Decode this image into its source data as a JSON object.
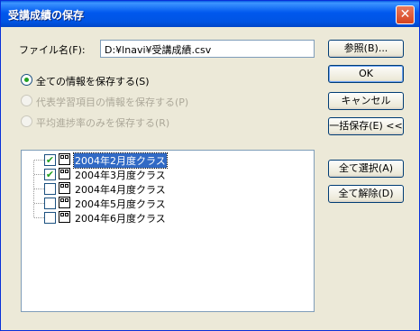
{
  "window": {
    "title": "受講成績の保存",
    "close_glyph": "✕"
  },
  "file": {
    "label": "ファイル名(F):",
    "value": "D:¥lnavi¥受講成績.csv"
  },
  "buttons": {
    "browse": "参照(B)...",
    "ok": "OK",
    "cancel": "キャンセル",
    "bulk_save": "一括保存(E) <<",
    "select_all": "全て選択(A)",
    "deselect_all": "全て解除(D)"
  },
  "options": [
    {
      "label": "全ての情報を保存する(S)",
      "selected": true,
      "enabled": true
    },
    {
      "label": "代表学習項目の情報を保存する(P)",
      "selected": false,
      "enabled": false
    },
    {
      "label": "平均進捗率のみを保存する(R)",
      "selected": false,
      "enabled": false
    }
  ],
  "classes": [
    {
      "label": "2004年2月度クラス",
      "checked": true,
      "selected": true
    },
    {
      "label": "2004年3月度クラス",
      "checked": true,
      "selected": false
    },
    {
      "label": "2004年4月度クラス",
      "checked": false,
      "selected": false
    },
    {
      "label": "2004年5月度クラス",
      "checked": false,
      "selected": false
    },
    {
      "label": "2004年6月度クラス",
      "checked": false,
      "selected": false
    }
  ],
  "check_glyph": "✔"
}
